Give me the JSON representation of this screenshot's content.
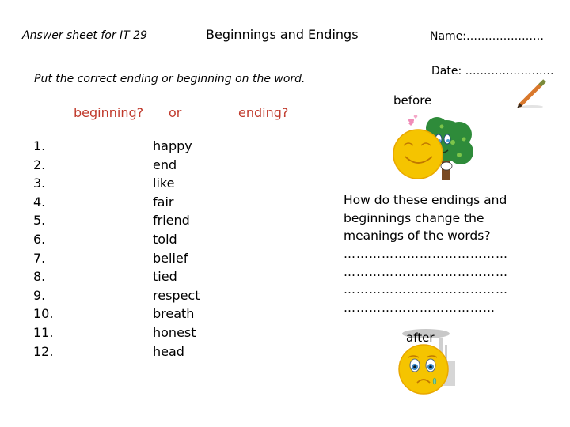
{
  "header": {
    "left_label": "Answer sheet for IT 29",
    "title": "Beginnings and Endings",
    "name_label": "Name:…………………",
    "date_label": "Date: ……………………"
  },
  "instruction": "Put the correct ending or beginning on the word.",
  "columns": {
    "beginning": "beginning?",
    "or": "or",
    "ending": "ending?",
    "heading_color": "#c0392b"
  },
  "items": [
    {
      "number": "1.",
      "word": "happy"
    },
    {
      "number": "2.",
      "word": "end"
    },
    {
      "number": "3.",
      "word": "like"
    },
    {
      "number": "4.",
      "word": "fair"
    },
    {
      "number": "5.",
      "word": "friend"
    },
    {
      "number": "6.",
      "word": "told"
    },
    {
      "number": "7.",
      "word": "belief"
    },
    {
      "number": "8.",
      "word": "tied"
    },
    {
      "number": "9.",
      "word": "respect"
    },
    {
      "number": "10.",
      "word": "breath"
    },
    {
      "number": "11.",
      "word": "honest"
    },
    {
      "number": "12.",
      "word": "head"
    }
  ],
  "before_label": "before",
  "after_label": "after",
  "question": {
    "lines": [
      "How do these endings and",
      "beginnings change the",
      "meanings of the words?"
    ],
    "answer_lines": [
      "…………………………………",
      "…………………………………",
      "…………………………………",
      "………………………………"
    ]
  },
  "icons": {
    "pencil": "pencil-icon",
    "happy_sun_tree": "happy-sun-hugging-tree-illustration",
    "sad_face_factory": "sad-face-factory-illustration"
  }
}
